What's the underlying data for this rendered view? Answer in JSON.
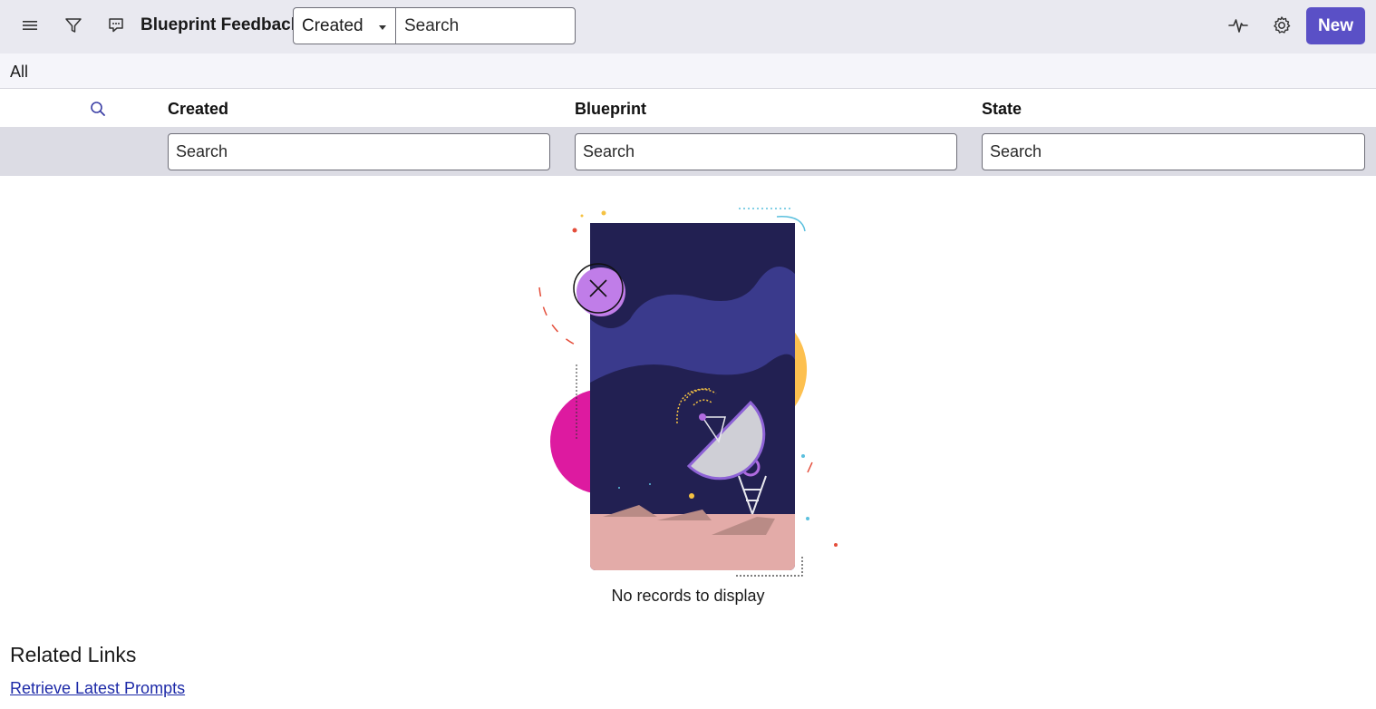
{
  "header": {
    "title": "Blueprint Feedback",
    "field_select_value": "Created",
    "search_placeholder": "Search",
    "new_button_label": "New",
    "accent_color": "#5a50c6",
    "icons": [
      "menu-icon",
      "filter-icon",
      "chat-icon",
      "activity-icon",
      "gear-icon"
    ]
  },
  "breadcrumb": {
    "label": "All"
  },
  "table": {
    "columns": [
      {
        "label": "Created",
        "search_placeholder": "Search"
      },
      {
        "label": "Blueprint",
        "search_placeholder": "Search"
      },
      {
        "label": "State",
        "search_placeholder": "Search"
      }
    ],
    "empty_message": "No records to display"
  },
  "related": {
    "title": "Related Links",
    "links": [
      "Retrieve Latest Prompts"
    ]
  }
}
